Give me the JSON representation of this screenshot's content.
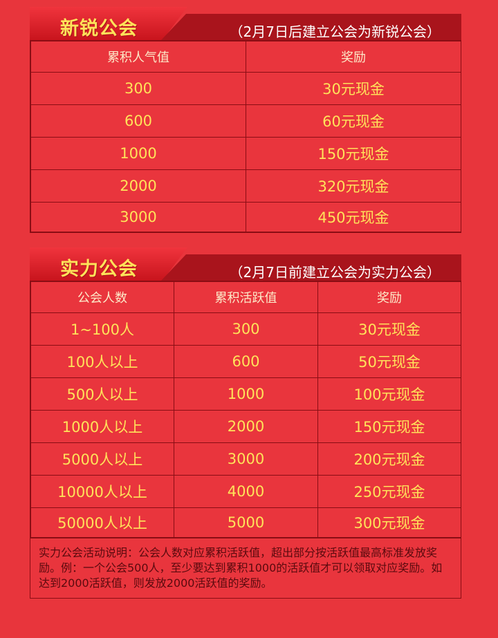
{
  "section1": {
    "title": "新锐公会",
    "subtitle": "（2月7日后建立公会为新锐公会）",
    "headers": [
      "累积人气值",
      "奖励"
    ],
    "rows": [
      [
        "300",
        "30元现金"
      ],
      [
        "600",
        "60元现金"
      ],
      [
        "1000",
        "150元现金"
      ],
      [
        "2000",
        "320元现金"
      ],
      [
        "3000",
        "450元现金"
      ]
    ]
  },
  "section2": {
    "title": "实力公会",
    "subtitle": "（2月7日前建立公会为实力公会）",
    "headers": [
      "公会人数",
      "累积活跃值",
      "奖励"
    ],
    "rows": [
      [
        "1~100人",
        "300",
        "30元现金"
      ],
      [
        "100人以上",
        "600",
        "50元现金"
      ],
      [
        "500人以上",
        "1000",
        "100元现金"
      ],
      [
        "1000人以上",
        "2000",
        "150元现金"
      ],
      [
        "5000人以上",
        "3000",
        "200元现金"
      ],
      [
        "10000人以上",
        "4000",
        "250元现金"
      ],
      [
        "50000人以上",
        "5000",
        "300元现金"
      ]
    ],
    "note": "实力公会活动说明：公会人数对应累积活跃值，超出部分按活跃值最高标准发放奖励。例：一个公会500人，至少要达到累积1000的活跃值才可以领取对应奖励。如达到2000活跃值，则发放2000活跃值的奖励。"
  }
}
